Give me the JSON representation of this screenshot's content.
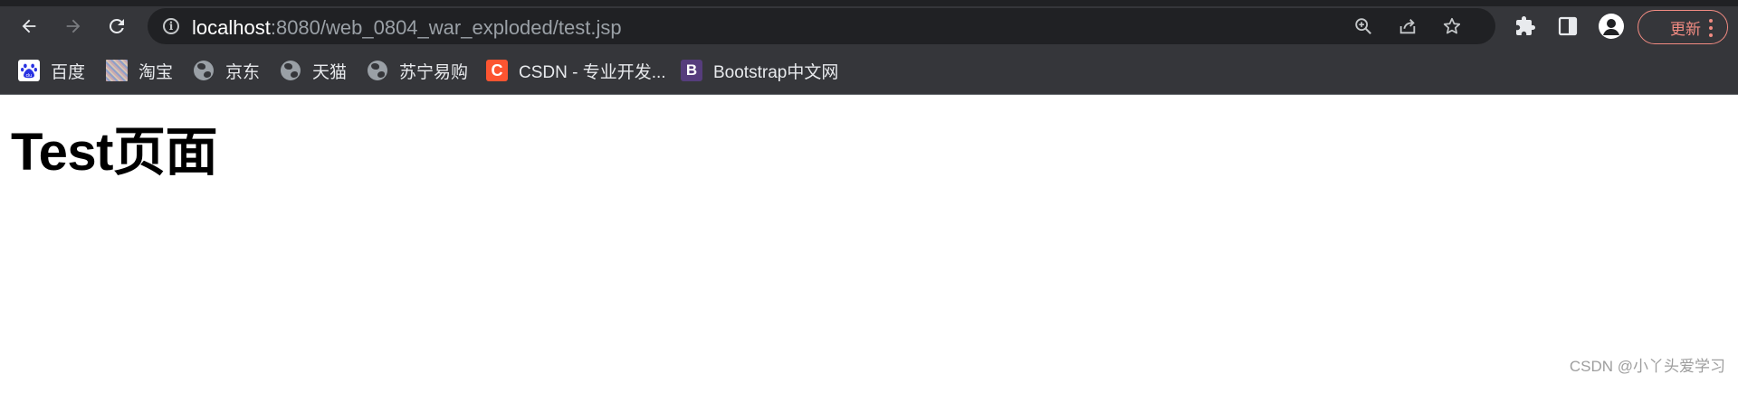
{
  "browser": {
    "address": {
      "host": "localhost",
      "path": ":8080/web_0804_war_exploded/test.jsp"
    },
    "update_label": "更新",
    "colors": {
      "frame": "#35363a",
      "omnibox": "#202124",
      "update_accent": "#f28b82"
    },
    "icons": {
      "back": "back-arrow-icon",
      "forward": "forward-arrow-icon",
      "reload": "reload-icon",
      "site_info": "info-icon",
      "zoom": "zoom-icon",
      "share": "share-icon",
      "bookmark": "star-icon",
      "extensions": "puzzle-icon",
      "side_panel": "side-panel-icon",
      "profile": "profile-icon",
      "menu": "more-vert-icon"
    }
  },
  "bookmarks": [
    {
      "label": "百度",
      "icon": "baidu-icon"
    },
    {
      "label": "淘宝",
      "icon": "taobao-icon"
    },
    {
      "label": "京东",
      "icon": "globe-icon"
    },
    {
      "label": "天猫",
      "icon": "globe-icon"
    },
    {
      "label": "苏宁易购",
      "icon": "globe-icon"
    },
    {
      "label": "CSDN - 专业开发...",
      "icon": "csdn-icon",
      "icon_text": "C",
      "icon_color": "#fc5531"
    },
    {
      "label": "Bootstrap中文网",
      "icon": "bootstrap-icon",
      "icon_text": "B",
      "icon_color": "#563d7c"
    }
  ],
  "page": {
    "heading": "Test页面",
    "watermark": "CSDN @小丫头爱学习"
  }
}
